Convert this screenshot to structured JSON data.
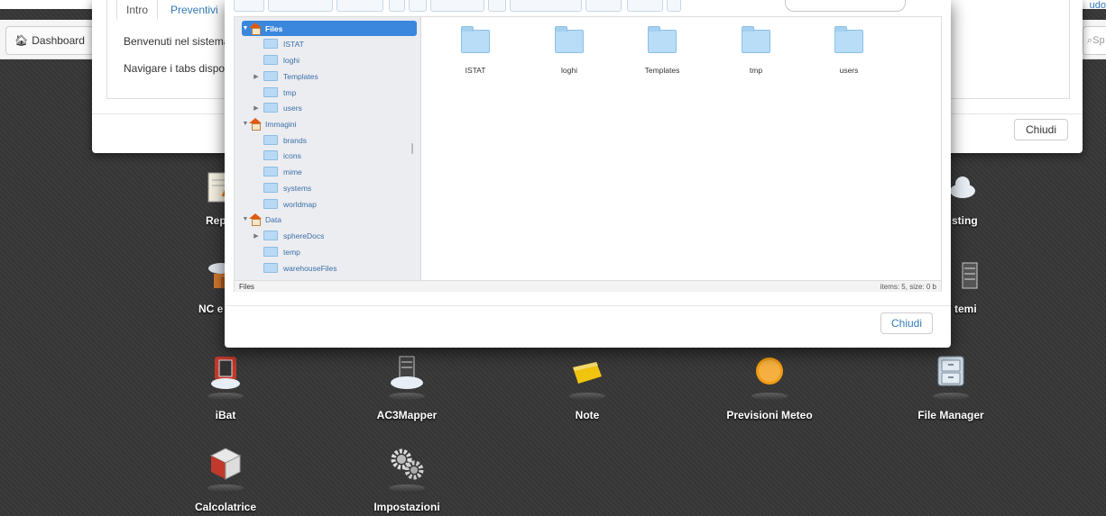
{
  "navbar": {
    "dashboard_label": "Dashboard",
    "search_placeholder": "Sp",
    "top_right_text": "udo"
  },
  "back_modal": {
    "tabs": [
      "Intro",
      "Preventivi"
    ],
    "text1": "Benvenuti nel sistema",
    "text2": "Navigare i tabs dispor",
    "close_label": "Chiudi"
  },
  "file_manager": {
    "tree": [
      {
        "label": "Files",
        "type": "root",
        "expanded": true,
        "selected": true
      },
      {
        "label": "ISTAT",
        "type": "folder"
      },
      {
        "label": "loghi",
        "type": "folder"
      },
      {
        "label": "Templates",
        "type": "folder",
        "expandable": true
      },
      {
        "label": "tmp",
        "type": "folder"
      },
      {
        "label": "users",
        "type": "folder",
        "expandable": true
      },
      {
        "label": "Immagini",
        "type": "root",
        "expanded": true
      },
      {
        "label": "brands",
        "type": "folder"
      },
      {
        "label": "icons",
        "type": "folder"
      },
      {
        "label": "mime",
        "type": "folder"
      },
      {
        "label": "systems",
        "type": "folder"
      },
      {
        "label": "worldmap",
        "type": "folder"
      },
      {
        "label": "Data",
        "type": "root",
        "expanded": true
      },
      {
        "label": "sphereDocs",
        "type": "folder",
        "expandable": true
      },
      {
        "label": "temp",
        "type": "folder"
      },
      {
        "label": "warehouseFiles",
        "type": "folder"
      }
    ],
    "items": [
      "ISTAT",
      "loghi",
      "Templates",
      "tmp",
      "users"
    ],
    "status_path": "Files",
    "status_info": "items: 5, size: 0 b",
    "close_label": "Chiudi"
  },
  "apps": [
    {
      "label": "Rep",
      "icon": "report-icon"
    },
    {
      "label": "sting",
      "icon": "cloud-icon"
    },
    {
      "label": "NC e",
      "icon": "nc-icon"
    },
    {
      "label": "temi",
      "icon": "server-icon"
    },
    {
      "label": "iBat",
      "icon": "server-cloud-red-icon"
    },
    {
      "label": "AC3Mapper",
      "icon": "server-cloud-icon"
    },
    {
      "label": "Note",
      "icon": "note-icon"
    },
    {
      "label": "Previsioni Meteo",
      "icon": "sun-icon"
    },
    {
      "label": "File Manager",
      "icon": "file-cabinet-icon"
    },
    {
      "label": "Calcolatrice",
      "icon": "calculator-cube-icon"
    },
    {
      "label": "Impostazioni",
      "icon": "gears-icon"
    }
  ],
  "colors": {
    "selection": "#3b87de",
    "link": "#337ab7",
    "folder": "#b9dcf7"
  }
}
